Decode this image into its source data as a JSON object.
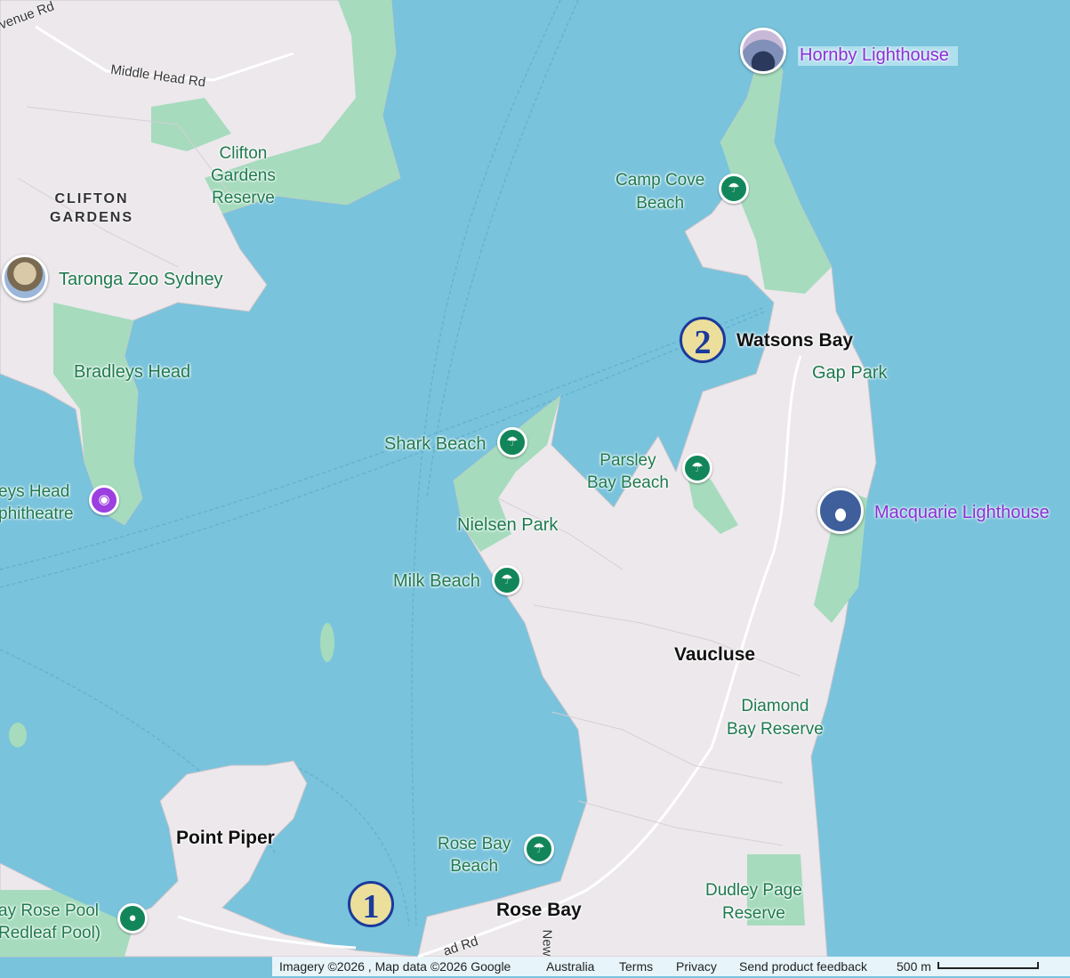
{
  "map": {
    "labels": {
      "avenue_rd": "venue Rd",
      "middle_head_rd": "Middle Head Rd",
      "clifton_gardens_reserve": "Clifton\nGardens\nReserve",
      "clifton_gardens": "CLIFTON\nGARDENS",
      "taronga_zoo": "Taronga Zoo Sydney",
      "bradleys_head": "Bradleys Head",
      "bradleys_amphitheatre": "eys Head\nphitheatre",
      "hornby_lighthouse": "Hornby Lighthouse",
      "camp_cove_beach": "Camp Cove\nBeach",
      "watsons_bay": "Watsons Bay",
      "gap_park": "Gap Park",
      "shark_beach": "Shark Beach",
      "parsley_bay_beach": "Parsley\nBay Beach",
      "macquarie_lighthouse": "Macquarie Lighthouse",
      "nielsen_park": "Nielsen Park",
      "milk_beach": "Milk Beach",
      "vaucluse": "Vaucluse",
      "diamond_bay_reserve": "Diamond\nBay Reserve",
      "point_piper": "Point Piper",
      "rose_bay_beach": "Rose Bay\nBeach",
      "rose_bay": "Rose Bay",
      "dudley_page_reserve": "Dudley Page\nReserve",
      "rose_bay_pool": "ay Rose Pool\nRedleaf Pool)",
      "new_south_head_rd": "ad Rd",
      "new_rd_vertical": "New"
    },
    "markers": [
      {
        "id": "1",
        "label": "1"
      },
      {
        "id": "2",
        "label": "2"
      }
    ]
  },
  "footer": {
    "imagery": "Imagery ©2026 , Map data ©2026 Google",
    "region": "Australia",
    "terms": "Terms",
    "privacy": "Privacy",
    "feedback": "Send product feedback",
    "scale": "500 m"
  },
  "colors": {
    "water": "#79c3dc",
    "land": "#ece8ec",
    "park": "#a6dbbd",
    "green_label": "#1e7a4e",
    "purple_label": "#8b2fd6",
    "marker_fill": "#ecdf9c",
    "marker_border": "#1a3a9c"
  },
  "icons": {
    "beach": "umbrella-icon",
    "park": "tree-icon",
    "attraction": "animal-icon",
    "pool": "circle-icon"
  }
}
